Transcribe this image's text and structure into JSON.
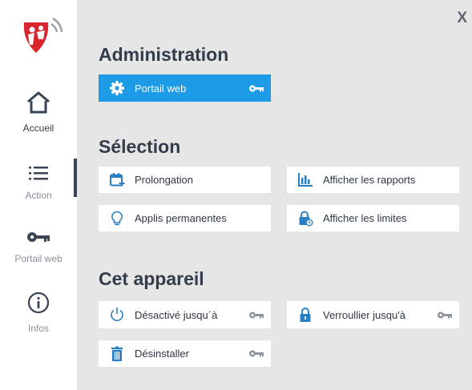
{
  "window": {
    "close_label": "X"
  },
  "nav": {
    "items": [
      {
        "id": "home",
        "label": "Accueil",
        "icon": "home-icon",
        "active": true
      },
      {
        "id": "action",
        "label": "Action",
        "icon": "list-icon",
        "active": false
      },
      {
        "id": "portal",
        "label": "Portail web",
        "icon": "key-icon",
        "active": false
      },
      {
        "id": "info",
        "label": "Infos",
        "icon": "info-icon",
        "active": false
      }
    ]
  },
  "sections": {
    "admin": {
      "title": "Administration",
      "portal_web": {
        "label": "Portail web",
        "icon": "gear-icon"
      }
    },
    "selection": {
      "title": "Sélection",
      "prolongation": {
        "label": "Prolongation",
        "icon": "calendar-plus-icon"
      },
      "reports": {
        "label": "Afficher les rapports",
        "icon": "bar-chart-icon"
      },
      "permanent_apps": {
        "label": "Applis permanentes",
        "icon": "lightbulb-icon"
      },
      "limits": {
        "label": "Afficher les limites",
        "icon": "lock-clock-icon"
      }
    },
    "device": {
      "title": "Cet appareil",
      "disabled_until": {
        "label": "Désactivé jusqu´à",
        "icon": "power-icon"
      },
      "locked_until": {
        "label": "Verroullier jusqu'à",
        "icon": "lock-icon"
      },
      "uninstall": {
        "label": "Désinstaller",
        "icon": "trash-icon"
      }
    }
  },
  "colors": {
    "accent": "#1e9be6",
    "icon_blue": "#2a7fc4",
    "sidebar_dark": "#3a4454",
    "heading": "#323c4b",
    "background": "#e6e6e6",
    "logo_red": "#d8262c"
  }
}
